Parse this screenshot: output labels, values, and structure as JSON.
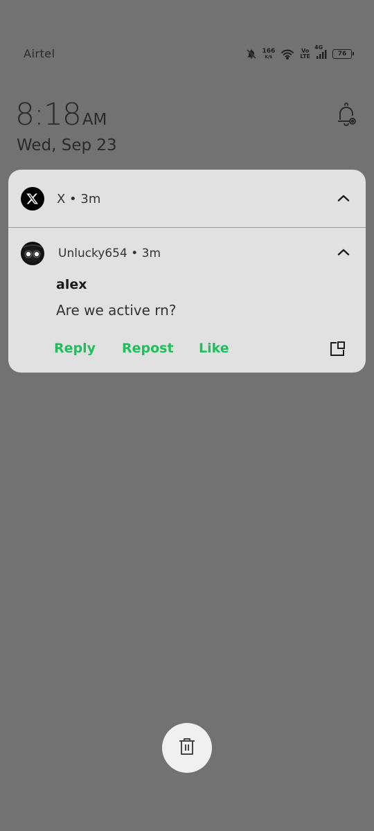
{
  "status_bar": {
    "carrier": "Airtel",
    "net_speed_value": "166",
    "net_speed_unit": "K/S",
    "volte_top": "Vo",
    "volte_bottom": "LTE",
    "network_type": "4G",
    "battery_level": "76",
    "icons": [
      "bell-off-icon",
      "wifi-icon",
      "signal-icon",
      "battery-icon"
    ]
  },
  "lockscreen": {
    "time": "8:18",
    "ampm": "AM",
    "date": "Wed, Sep 23"
  },
  "notification": {
    "app_header": "X • 3m",
    "sender_line": "Unlucky654 • 3m",
    "title": "alex",
    "body": "Are we active rn?",
    "actions": {
      "reply": "Reply",
      "repost": "Repost",
      "like": "Like"
    },
    "colors": {
      "action": "#1fbf5b",
      "card_bg": "#e1e1e1"
    }
  },
  "page": {
    "background": "#727272"
  }
}
